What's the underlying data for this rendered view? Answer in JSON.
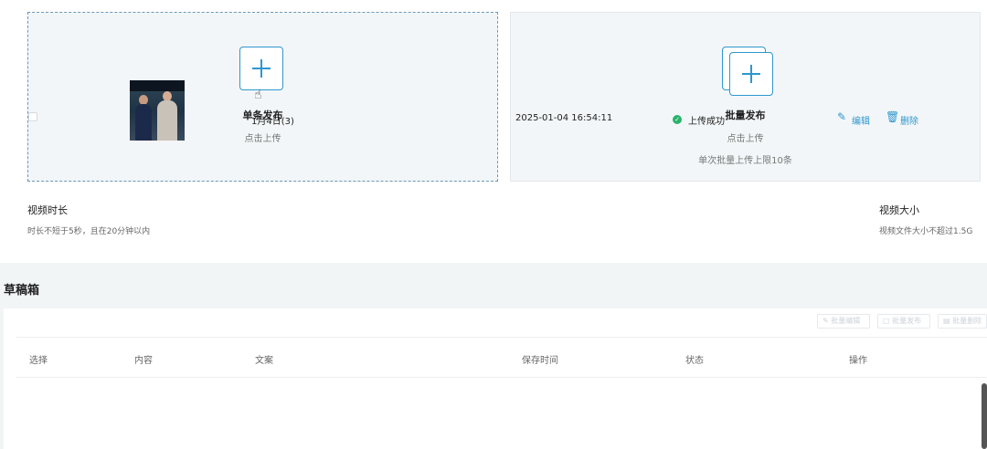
{
  "upload": {
    "single": {
      "title": "单条发布",
      "subtitle": "点击上传"
    },
    "batch": {
      "title": "批量发布",
      "subtitle": "点击上传",
      "limit": "单次批量上传上限10条"
    }
  },
  "requirements": {
    "duration": {
      "title": "视频时长",
      "desc": "时长不短于5秒，且在20分钟以内"
    },
    "size": {
      "title": "视频大小",
      "desc": "视频文件大小不超过1.5G"
    }
  },
  "drafts": {
    "title": "草稿箱",
    "toolbar": [
      "批量编辑",
      "批量发布",
      "批量删除"
    ],
    "columns": [
      "选择",
      "内容",
      "文案",
      "保存时间",
      "状态",
      "操作"
    ],
    "rows": [
      {
        "caption": "1月4日(3)",
        "saved_at": "2025-01-04 16:54:11",
        "status": "上传成功",
        "edit": "编辑",
        "delete": "删除"
      }
    ]
  },
  "colors": {
    "accent": "#2e97cf",
    "success": "#29b36b"
  }
}
